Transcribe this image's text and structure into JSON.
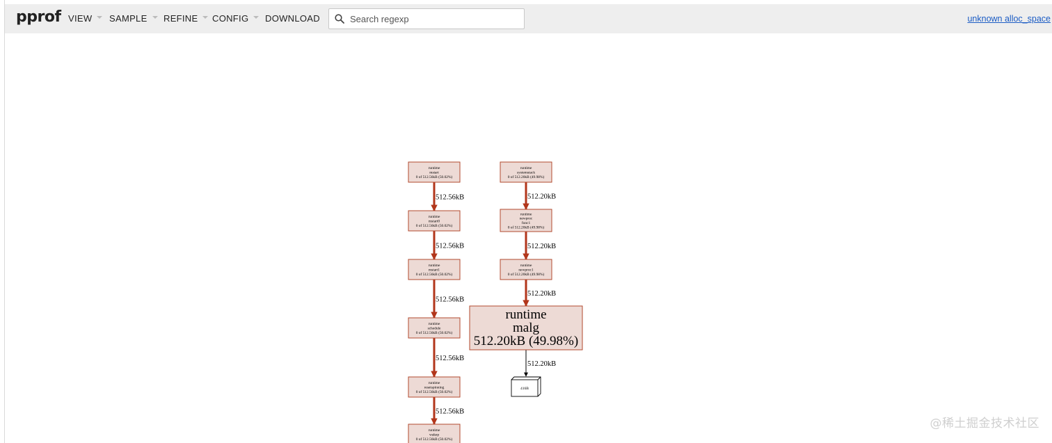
{
  "toolbar": {
    "logo": "pprof",
    "menu": [
      {
        "label": "VIEW",
        "has_dropdown": true
      },
      {
        "label": "SAMPLE",
        "has_dropdown": true
      },
      {
        "label": "REFINE",
        "has_dropdown": true
      },
      {
        "label": "CONFIG",
        "has_dropdown": true
      },
      {
        "label": "DOWNLOAD",
        "has_dropdown": false
      }
    ],
    "search_placeholder": "Search regexp",
    "search_icon": "search-icon",
    "profile_label": "unknown alloc_space"
  },
  "graph": {
    "node_fill": "#eddad5",
    "node_stroke": "#b2492e",
    "edge_color": "#b2361b",
    "nodes": [
      {
        "id": "mstart",
        "lines": [
          "runtime",
          "mstart",
          "0 of 512.56kB (50.02%)"
        ]
      },
      {
        "id": "mstart0",
        "lines": [
          "runtime",
          "mstart0",
          "0 of 512.56kB (50.02%)"
        ]
      },
      {
        "id": "mstart1",
        "lines": [
          "runtime",
          "mstart1",
          "0 of 512.56kB (50.02%)"
        ]
      },
      {
        "id": "schedule",
        "lines": [
          "runtime",
          "schedule",
          "0 of 512.56kB (50.02%)"
        ]
      },
      {
        "id": "resetspinning",
        "lines": [
          "runtime",
          "resetspinning",
          "0 of 512.56kB (50.02%)"
        ]
      },
      {
        "id": "wakep",
        "lines": [
          "runtime",
          "wakep",
          "0 of 512.56kB (50.02%)"
        ]
      },
      {
        "id": "systemstack",
        "lines": [
          "runtime",
          "systemstack",
          "0 of 512.20kB (49.98%)"
        ]
      },
      {
        "id": "newproc_func1",
        "lines": [
          "runtime",
          "newproc",
          "func1",
          "0 of 512.20kB (49.98%)"
        ]
      },
      {
        "id": "newproc1",
        "lines": [
          "runtime",
          "newproc1",
          "0 of 512.20kB (49.98%)"
        ]
      },
      {
        "id": "malg",
        "lines": [
          "runtime",
          "malg",
          "512.20kB (49.98%)"
        ]
      },
      {
        "id": "alloc_416B",
        "lines": [
          "416B"
        ]
      }
    ],
    "edges": [
      {
        "from": "mstart",
        "to": "mstart0",
        "label": "512.56kB"
      },
      {
        "from": "mstart0",
        "to": "mstart1",
        "label": "512.56kB"
      },
      {
        "from": "mstart1",
        "to": "schedule",
        "label": "512.56kB"
      },
      {
        "from": "schedule",
        "to": "resetspinning",
        "label": "512.56kB"
      },
      {
        "from": "resetspinning",
        "to": "wakep",
        "label": "512.56kB"
      },
      {
        "from": "systemstack",
        "to": "newproc_func1",
        "label": "512.20kB"
      },
      {
        "from": "newproc_func1",
        "to": "newproc1",
        "label": "512.20kB"
      },
      {
        "from": "newproc1",
        "to": "malg",
        "label": "512.20kB"
      },
      {
        "from": "malg",
        "to": "alloc_416B",
        "label": "512.20kB"
      }
    ]
  },
  "watermark": "@稀土掘金技术社区"
}
